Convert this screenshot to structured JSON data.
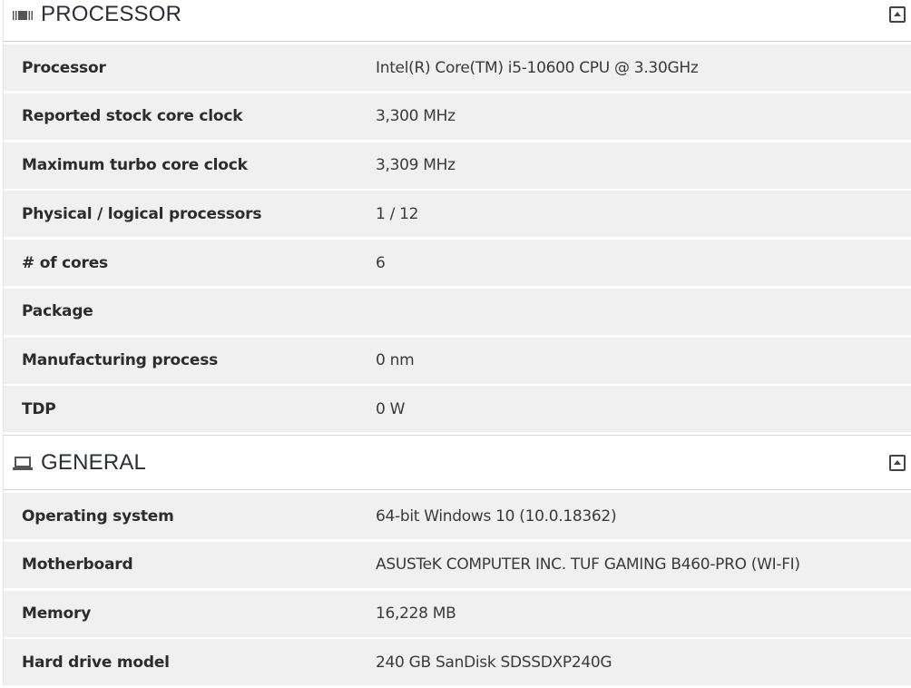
{
  "sections": {
    "processor": {
      "title": "PROCESSOR",
      "icon": "processor-chip-icon",
      "collapse_icon": "collapse-up-icon",
      "rows": [
        {
          "label": "Processor",
          "value": "Intel(R) Core(TM) i5-10600 CPU @ 3.30GHz"
        },
        {
          "label": "Reported stock core clock",
          "value": "3,300 MHz"
        },
        {
          "label": "Maximum turbo core clock",
          "value": "3,309 MHz"
        },
        {
          "label": "Physical / logical processors",
          "value": "1 / 12"
        },
        {
          "label": "# of cores",
          "value": "6"
        },
        {
          "label": "Package",
          "value": ""
        },
        {
          "label": "Manufacturing process",
          "value": "0 nm"
        },
        {
          "label": "TDP",
          "value": "0 W"
        }
      ]
    },
    "general": {
      "title": "GENERAL",
      "icon": "laptop-icon",
      "collapse_icon": "collapse-up-icon",
      "rows": [
        {
          "label": "Operating system",
          "value": "64-bit Windows 10 (10.0.18362)"
        },
        {
          "label": "Motherboard",
          "value": "ASUSTeK COMPUTER INC. TUF GAMING B460-PRO (WI-FI)"
        },
        {
          "label": "Memory",
          "value": "16,228 MB"
        },
        {
          "label": "Hard drive model",
          "value": "240 GB SanDisk SDSSDXP240G"
        }
      ]
    }
  }
}
